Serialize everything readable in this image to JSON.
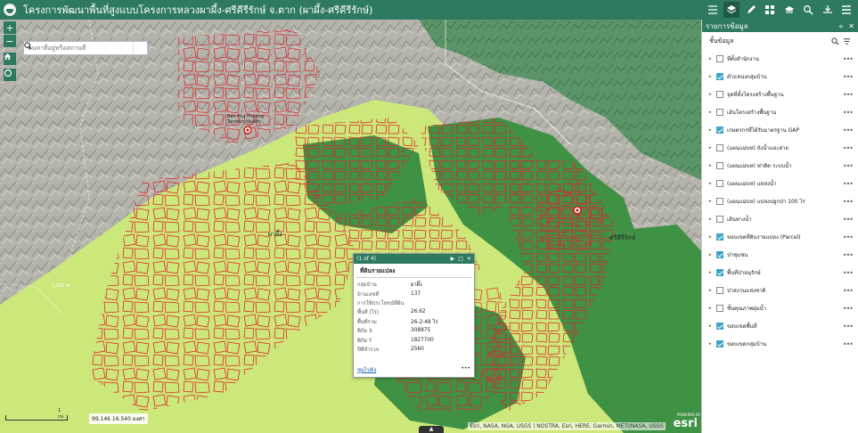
{
  "header": {
    "title": "โครงการพัฒนาพื้นที่สูงแบบโครงการหลวงผาผึ้ง-ศรีคีรีรักษ์ จ.ตาก (ผาผึ้ง-ศรีคีรีรักษ์)"
  },
  "search": {
    "placeholder": "ค้นหาที่อยู่หรือสถานที่"
  },
  "map": {
    "zoom_in": "+",
    "zoom_out": "−",
    "labels": {
      "place1": "ผาผึ้ง",
      "place2": "ศรีคีรีรักษ์",
      "poi": "Ban Pha Phueng Tambon Health",
      "contour": "1,200 m"
    },
    "coords": "99.146 16.540 องศา",
    "scale": "1 กม",
    "attribution": "Esri, NASA, NGA, USGS | NOSTRA, Esri, HERE, Garmin, METI/NASA, USGS",
    "esri_label": "esri",
    "esri_powered": "POWERED BY",
    "toggle": "▲"
  },
  "popup": {
    "counter": "(1 of 4)",
    "title": "ที่ดินรายแปลง",
    "fields": [
      {
        "k": "กลุ่มบ้าน",
        "v": "ผาผึ้ง"
      },
      {
        "k": "บ้านเลขที่",
        "v": "137"
      },
      {
        "k": "การใช้ประโยชน์ที่ดิน",
        "v": ""
      },
      {
        "k": "พื้นที่ (ไร่)",
        "v": "26.62"
      },
      {
        "k": "พื้นที่รวม",
        "v": "26-2-48 ไร่"
      },
      {
        "k": "พิกัด X",
        "v": "308875"
      },
      {
        "k": "พิกัด Y",
        "v": "1827700"
      },
      {
        "k": "ปีที่สำรวจ",
        "v": "2560"
      }
    ],
    "zoom_link": "ซูมไปยัง",
    "more": "•••"
  },
  "panel": {
    "title": "รายการข้อมูล",
    "subtitle": "ชั้นข้อมูล",
    "layers": [
      {
        "label": "ที่ตั้งสำนักงาน",
        "on": false
      },
      {
        "label": "ตำแหน่งกลุ่มบ้าน",
        "on": true
      },
      {
        "label": "จุดที่ตั้งโครงสร้างพื้นฐาน",
        "on": false
      },
      {
        "label": "เส้นโครงสร้างพื้นฐาน",
        "on": false
      },
      {
        "label": "เกษตรกรที่ได้รับมาตรฐาน GAP",
        "on": true
      },
      {
        "label": "(แผนแม่บท) ถังน้ำและฝาย",
        "on": false
      },
      {
        "label": "(แผนแม่บท) ฟาติด ระบบน้ำ",
        "on": false
      },
      {
        "label": "(แผนแม่บท) แหล่งน้ำ",
        "on": false
      },
      {
        "label": "(แผนแม่บท) แปลงปลูกป่า 100 ไร่",
        "on": false
      },
      {
        "label": "เส้นทางน้ำ",
        "on": false
      },
      {
        "label": "ขอบเขตที่ดินรายแปลง (Parcel)",
        "on": true
      },
      {
        "label": "ป่าชุมชน",
        "on": true
      },
      {
        "label": "พื้นที่ป่าอนุรักษ์",
        "on": true
      },
      {
        "label": "ป่าสงวนแห่งชาติ",
        "on": false
      },
      {
        "label": "ชั้นคุณภาพลุ่มน้ำ",
        "on": false
      },
      {
        "label": "ขอบเขตพื้นที่",
        "on": true
      },
      {
        "label": "ขอบเขตกลุ่มบ้าน",
        "on": true
      }
    ]
  },
  "colors": {
    "brand": "#2d7a5f",
    "parcel": "#e0262a",
    "light_green": "#cde87a",
    "dark_green": "#3f9144"
  }
}
